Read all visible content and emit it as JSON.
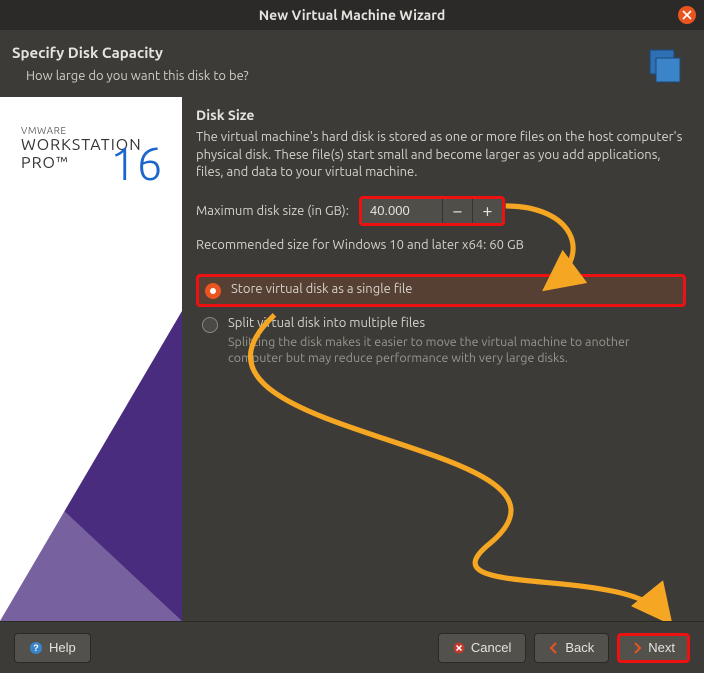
{
  "window": {
    "title": "New Virtual Machine Wizard"
  },
  "header": {
    "title": "Specify Disk Capacity",
    "subtitle": "How large do you want this disk to be?"
  },
  "sidebar": {
    "brand_tag": "VMWARE",
    "brand_line1": "WORKSTATION",
    "brand_line2": "PRO™",
    "version": "16"
  },
  "main": {
    "section_title": "Disk Size",
    "description": "The virtual machine's hard disk is stored as one or more files on the host computer's physical disk. These file(s) start small and become larger as you add applications, files, and data to your virtual machine.",
    "max_label": "Maximum disk size (in GB):",
    "max_value": "40.000",
    "recommended": "Recommended size for Windows 10 and later x64: 60 GB",
    "radio": {
      "single": "Store virtual disk as a single file",
      "split": "Split virtual disk into multiple files",
      "split_hint": "Splitting the disk makes it easier to move the virtual machine to another computer but may reduce performance with very large disks.",
      "selected": "single"
    }
  },
  "footer": {
    "help": "Help",
    "cancel": "Cancel",
    "back": "Back",
    "next": "Next"
  },
  "colors": {
    "highlight": "#e11",
    "accent": "#e95420",
    "arrow": "#f5a623"
  }
}
